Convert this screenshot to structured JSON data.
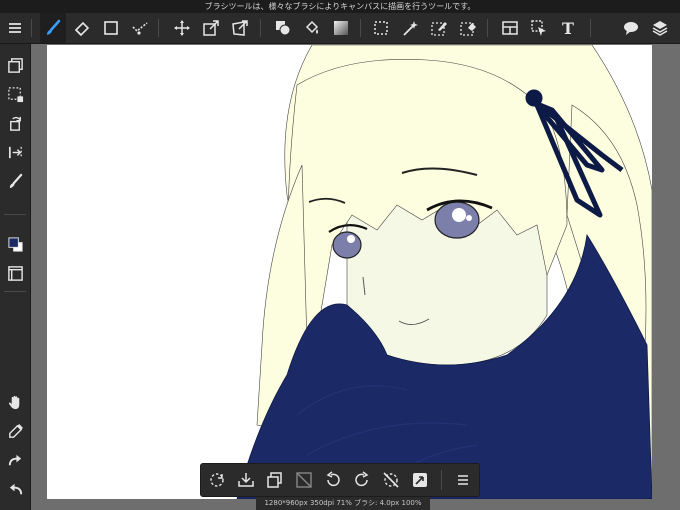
{
  "status_bar": {
    "hint": "ブラシツールは、様々なブラシによりキャンバスに描画を行うツールです。"
  },
  "toolbar": {
    "text_tool_label": "T",
    "tools": [
      "menu-icon",
      "brush-icon",
      "eraser-icon",
      "rectangle-icon",
      "snap-icon",
      "move-icon",
      "transform-icon",
      "deform-icon",
      "fill-icon",
      "bucket-icon",
      "gradient-icon",
      "select-rect-icon",
      "magic-wand-icon",
      "select-pen-icon",
      "select-eraser-icon",
      "frame-icon",
      "layer-move-icon",
      "text-icon",
      "balloon-icon",
      "layers-icon"
    ]
  },
  "left_toolbar": {
    "tools": [
      "layer-copy-icon",
      "selection-icon",
      "rotate-layer-icon",
      "flip-icon",
      "brush-size-icon",
      "color-icon",
      "panel-icon",
      "hand-icon",
      "eyedropper-icon",
      "redo-icon",
      "undo-icon"
    ],
    "foreground_color": "#1b2a66",
    "background_color": "#ffffff"
  },
  "bottom_toolbar": {
    "tools": [
      "deselect-icon",
      "clear-selection-icon",
      "copy-icon",
      "invert-icon",
      "rotate-left-icon",
      "rotate-right-icon",
      "flip-off-icon",
      "snap-toggle-icon",
      "menu-icon"
    ]
  },
  "info": {
    "canvas_info": "1280*960px 350dpi 71% ブラシ: 4.0px 100%"
  },
  "colors": {
    "hair": "#fdfde0",
    "skin": "#f6f8e6",
    "scarf": "#1b2a66",
    "ribbon": "#0d1a45",
    "eye": "#7b7fa9",
    "toolbar": "#2b2b2b",
    "accent": "#3aa0ff"
  }
}
